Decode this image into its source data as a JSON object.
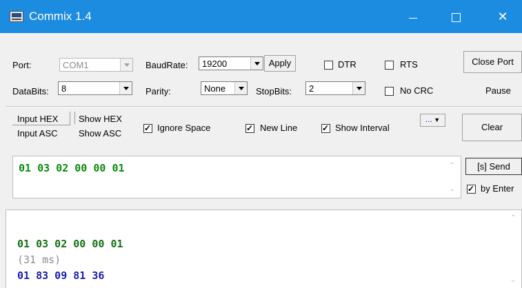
{
  "window": {
    "title": "Commix 1.4"
  },
  "settings": {
    "port_label": "Port:",
    "port_value": "COM1",
    "baud_label": "BaudRate:",
    "baud_value": "19200",
    "apply_label": "Apply",
    "dtr_label": "DTR",
    "rts_label": "RTS",
    "close_port_label": "Close Port",
    "databits_label": "DataBits:",
    "databits_value": "8",
    "parity_label": "Parity:",
    "parity_value": "None",
    "stopbits_label": "StopBits:",
    "stopbits_value": "2",
    "nocrc_label": "No CRC",
    "pause_label": "Pause"
  },
  "options": {
    "input_hex": "Input HEX",
    "input_asc": "Input ASC",
    "show_hex": "Show HEX",
    "show_asc": "Show ASC",
    "ignore_space": "Ignore Space",
    "ignore_space_checked": true,
    "new_line": "New Line",
    "new_line_checked": true,
    "show_interval": "Show Interval",
    "show_interval_checked": true,
    "more_label": "...",
    "clear_label": "Clear"
  },
  "send": {
    "input_value": "01 03 02 00 00 01",
    "send_label": "[s] Send",
    "by_enter_label": "by Enter",
    "by_enter_checked": true
  },
  "output": {
    "lines": [
      {
        "text": "01 03 02 00 00 01",
        "kind": "sent"
      },
      {
        "text": "(31 ms)",
        "kind": "interval"
      },
      {
        "text": "01 83 09 81 36",
        "kind": "received"
      }
    ]
  }
}
